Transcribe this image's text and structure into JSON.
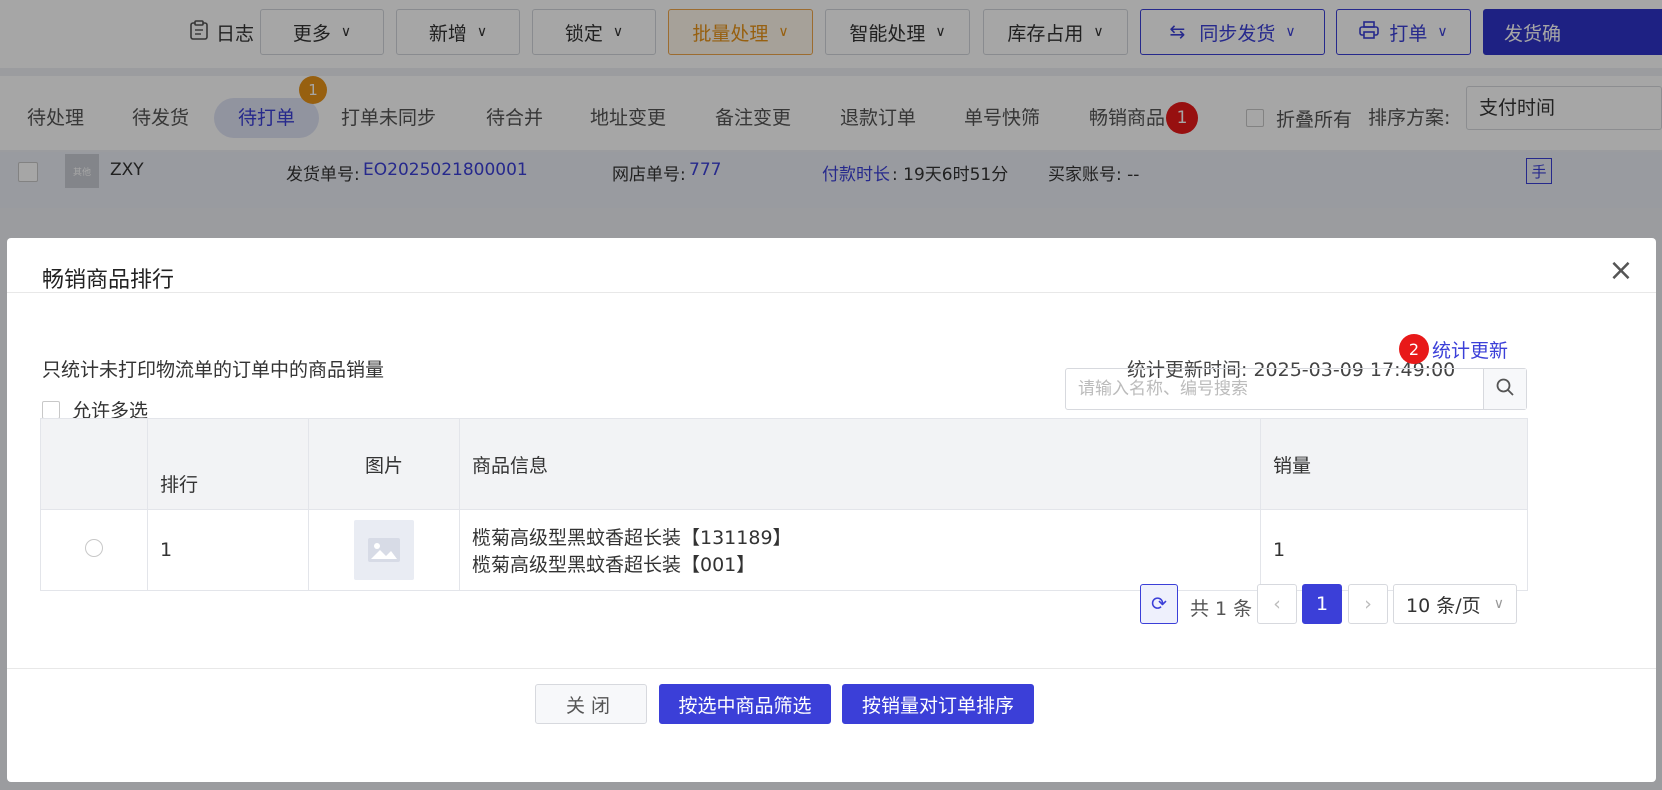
{
  "toolbar": {
    "log_label": "日志",
    "buttons": [
      "更多",
      "新增",
      "锁定",
      "批量处理",
      "智能处理",
      "库存占用",
      "同步发货",
      "打单",
      "发货确"
    ]
  },
  "tabs": {
    "items": [
      "待处理",
      "待发货",
      "待打单",
      "打单未同步",
      "待合并",
      "地址变更",
      "备注变更",
      "退款订单",
      "单号快筛",
      "畅销商品"
    ],
    "active_badge": "1",
    "marker_1": "1",
    "collapse_all": "折叠所有",
    "sort_label": "排序方案:",
    "sort_value": "支付时间"
  },
  "order": {
    "shop": "ZXY",
    "shop_tag": "其他",
    "ship_no_label": "发货单号:",
    "ship_no": "EO2025021800001",
    "shop_order_label": "网店单号:",
    "shop_order": "777",
    "pay_time_label": "付款时长",
    "pay_time": ": 19天6时51分",
    "buyer_label": "买家账号: --",
    "hand_icon": "手"
  },
  "modal": {
    "title": "畅销商品排行",
    "note": "只统计未打印物流单的订单中的商品销量",
    "allow_multi": "允许多选",
    "stat_time_label": "统计更新时间:",
    "stat_time": "2025-03-09 17:49:00",
    "marker_2": "2",
    "stat_update": "统计更新",
    "search_placeholder": "请输入名称、编号搜索",
    "columns": [
      "排行",
      "图片",
      "商品信息",
      "销量"
    ],
    "rows": [
      {
        "rank": "1",
        "info_line1": "榄菊高级型黑蚊香超长装【131189】",
        "info_line2": "榄菊高级型黑蚊香超长装【001】",
        "sales": "1"
      }
    ],
    "pager": {
      "total": "共 1 条",
      "page": "1",
      "page_size": "10 条/页"
    },
    "buttons": {
      "close": "关闭",
      "filter": "按选中商品筛选",
      "sort": "按销量对订单排序"
    }
  },
  "colors": {
    "primary": "#3b3fd8",
    "marker": "#e81919",
    "badge": "#e8941a"
  }
}
